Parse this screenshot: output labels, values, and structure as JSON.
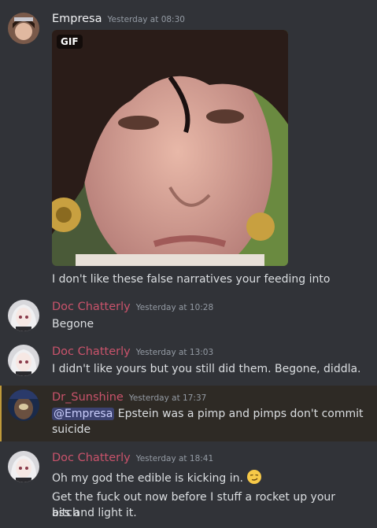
{
  "messages": [
    {
      "author": "Empresa",
      "author_color": "#f2f3f5",
      "timestamp": "Yesterday at 08:30",
      "gif_badge": "GIF",
      "text": "I don't like these false narratives your feeding into"
    },
    {
      "author": "Doc Chatterly",
      "author_color": "#c9536b",
      "timestamp": "Yesterday at 10:28",
      "text": "Begone"
    },
    {
      "author": "Doc Chatterly",
      "author_color": "#c9536b",
      "timestamp": "Yesterday at 13:03",
      "text": "I didn't like yours but you still did them. Begone, diddla."
    },
    {
      "author": "Dr_Sunshine",
      "author_color": "#c9536b",
      "timestamp": "Yesterday at 17:37",
      "mention": "@Empresa",
      "text_after_mention": " Epstein was a pimp and pimps don't commit",
      "text_line2": "suicide"
    },
    {
      "author": "Doc Chatterly",
      "author_color": "#c9536b",
      "timestamp": "Yesterday at 18:41",
      "text": "Oh my god the edible is kicking in.",
      "emoji_icon": "smirking-face-emoji",
      "text2_line1": "Get the fuck out now before I stuff a rocket up your bitch",
      "text2_line2": "ass and light it."
    }
  ]
}
